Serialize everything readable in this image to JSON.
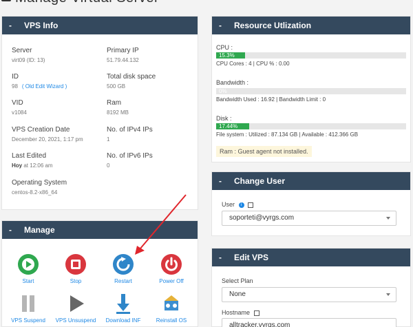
{
  "page": {
    "title": "Manage Virtual Server"
  },
  "vps_info": {
    "header": "VPS Info",
    "server_label": "Server",
    "server_value": "virt09 (ID: 13)",
    "primary_ip_label": "Primary IP",
    "primary_ip_value": "51.79.44.132",
    "id_label": "ID",
    "id_value": "98",
    "id_link": "( Old Edit Wizard )",
    "disk_label": "Total disk space",
    "disk_value": "500 GB",
    "vid_label": "VID",
    "vid_value": "v1084",
    "ram_label": "Ram",
    "ram_value": "8192 MB",
    "creation_label": "VPS Creation Date",
    "creation_value": "December 20, 2021, 1:17 pm",
    "ipv4_label": "No. of IPv4 IPs",
    "ipv4_value": "1",
    "edited_label": "Last Edited",
    "edited_strong": "Hoy",
    "edited_rest": " at 12:06 am",
    "ipv6_label": "No. of IPv6 IPs",
    "ipv6_value": "0",
    "os_label": "Operating System",
    "os_value": "centos-8.2-x86_64"
  },
  "resources": {
    "header": "Resource Utlization",
    "cpu_label": "CPU :",
    "cpu_percent": 15.3,
    "cpu_bar_text": "15.3%",
    "cpu_sub": "CPU Cores : 4  |  CPU % : 0.00",
    "bw_label": "Bandwidth :",
    "bw_percent": 0,
    "bw_bar_text": "0%",
    "bw_sub": "Bandwidth Used : 16.92  |  Bandwidth Limit : 0",
    "disk_label": "Disk :",
    "disk_percent": 17.44,
    "disk_bar_text": "17.44%",
    "disk_sub": "File system : Utilized : 87.134 GB   |   Available : 412.366 GB",
    "ram_note": "Ram : Guest agent not installed."
  },
  "change_user": {
    "header": "Change User",
    "user_label": "User",
    "user_value": "soporteti@vyrgs.com"
  },
  "manage": {
    "header": "Manage",
    "actions": [
      {
        "label": "Start"
      },
      {
        "label": "Stop"
      },
      {
        "label": "Restart"
      },
      {
        "label": "Power Off"
      },
      {
        "label": "VPS Suspend"
      },
      {
        "label": "VPS Unsuspend"
      },
      {
        "label": "Download INF"
      },
      {
        "label": "Reinstall OS"
      }
    ]
  },
  "edit_vps": {
    "header": "Edit VPS",
    "plan_label": "Select Plan",
    "plan_value": "None",
    "hostname_label": "Hostname",
    "hostname_value": "alltracker.vyrgs.com"
  },
  "colors": {
    "header_bg": "#34495e",
    "accent": "#1e88e5",
    "success": "#2fa84f",
    "danger": "#d9363e"
  }
}
